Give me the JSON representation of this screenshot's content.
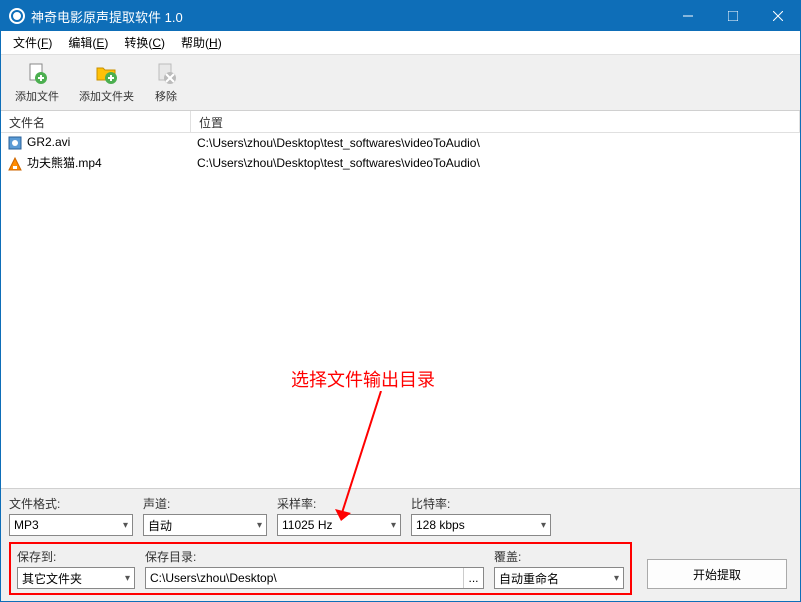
{
  "window": {
    "title": "神奇电影原声提取软件 1.0"
  },
  "menu": {
    "file": "文件(",
    "file_key": "F",
    "file_close": ")",
    "edit": "编辑(",
    "edit_key": "E",
    "edit_close": ")",
    "convert": "转换(",
    "convert_key": "C",
    "convert_close": ")",
    "help": "帮助(",
    "help_key": "H",
    "help_close": ")"
  },
  "toolbar": {
    "add_file": "添加文件",
    "add_folder": "添加文件夹",
    "remove": "移除"
  },
  "columns": {
    "filename": "文件名",
    "location": "位置"
  },
  "rows": [
    {
      "name": "GR2.avi",
      "path": "C:\\Users\\zhou\\Desktop\\test_softwares\\videoToAudio\\",
      "icon": "avi"
    },
    {
      "name": "功夫熊猫.mp4",
      "path": "C:\\Users\\zhou\\Desktop\\test_softwares\\videoToAudio\\",
      "icon": "mp4"
    }
  ],
  "annotation": {
    "text": "选择文件输出目录"
  },
  "options": {
    "format_label": "文件格式:",
    "format_value": "MP3",
    "channel_label": "声道:",
    "channel_value": "自动",
    "rate_label": "采样率:",
    "rate_value": "11025 Hz",
    "bitrate_label": "比特率:",
    "bitrate_value": "128 kbps",
    "saveto_label": "保存到:",
    "saveto_value": "其它文件夹",
    "savedir_label": "保存目录:",
    "savedir_value": "C:\\Users\\zhou\\Desktop\\",
    "browse": "...",
    "overwrite_label": "覆盖:",
    "overwrite_value": "自动重命名"
  },
  "action": "开始提取"
}
